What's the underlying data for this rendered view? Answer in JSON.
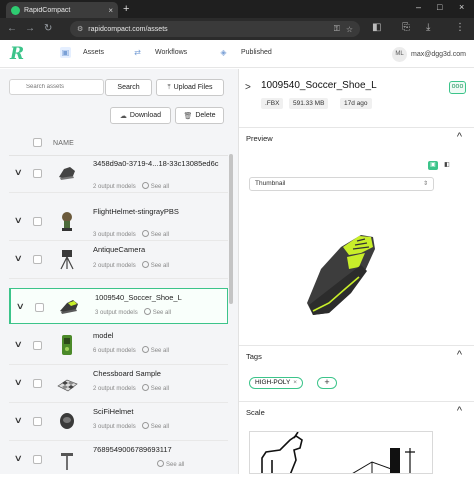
{
  "browser": {
    "tab_title": "RapidCompact",
    "tab_close": "×",
    "new_tab": "+",
    "url": "rapidcompact.com/assets",
    "window_controls": [
      "–",
      "□",
      "×"
    ]
  },
  "header": {
    "logo": "R",
    "nav": [
      {
        "label": "Assets",
        "icon": "assets-icon"
      },
      {
        "label": "Workflows",
        "icon": "workflows-icon"
      },
      {
        "label": "Published",
        "icon": "published-icon"
      }
    ],
    "user_initials": "ML",
    "user_email": "max@dgg3d.com"
  },
  "toolbar": {
    "search_placeholder": "Search assets",
    "search_label": "Search",
    "upload_label": "Upload Files",
    "download_label": "Download",
    "delete_label": "Delete"
  },
  "list": {
    "column_name": "NAME",
    "see_all": "See all",
    "rows": [
      {
        "title": "3458d9a0-3719-4...18-33c13085ed6c",
        "sub": "2 output models",
        "thumb": "shoe-dark"
      },
      {
        "title": "FlightHelmet-stingrayPBS",
        "sub": "3 output models",
        "thumb": "helmet"
      },
      {
        "title": "AntiqueCamera",
        "sub": "2 output models",
        "thumb": "tripod-camera"
      },
      {
        "title": "1009540_Soccer_Shoe_L",
        "sub": "3 output models",
        "thumb": "soccer-shoe"
      },
      {
        "title": "model",
        "sub": "6 output models",
        "thumb": "green-device"
      },
      {
        "title": "Chessboard Sample",
        "sub": "2 output models",
        "thumb": "chessboard"
      },
      {
        "title": "SciFiHelmet",
        "sub": "3 output models",
        "thumb": "scifi-helmet"
      },
      {
        "title": "7689549006789693117",
        "sub": "",
        "thumb": "lamp"
      }
    ]
  },
  "detail": {
    "title": "1009540_Soccer_Shoe_L",
    "format": ".FBX",
    "size": "591.33 MB",
    "age": "17d ago",
    "more": "ooo",
    "preview_label": "Preview",
    "view_select": "Thumbnail",
    "tags_label": "Tags",
    "tags": [
      "HIGH-POLY"
    ],
    "add_tag": "+",
    "scale_label": "Scale"
  },
  "colors": {
    "accent": "#3cc48a",
    "chrome_dark": "#1f1f1f",
    "panel_bg": "#f4f5f7"
  }
}
